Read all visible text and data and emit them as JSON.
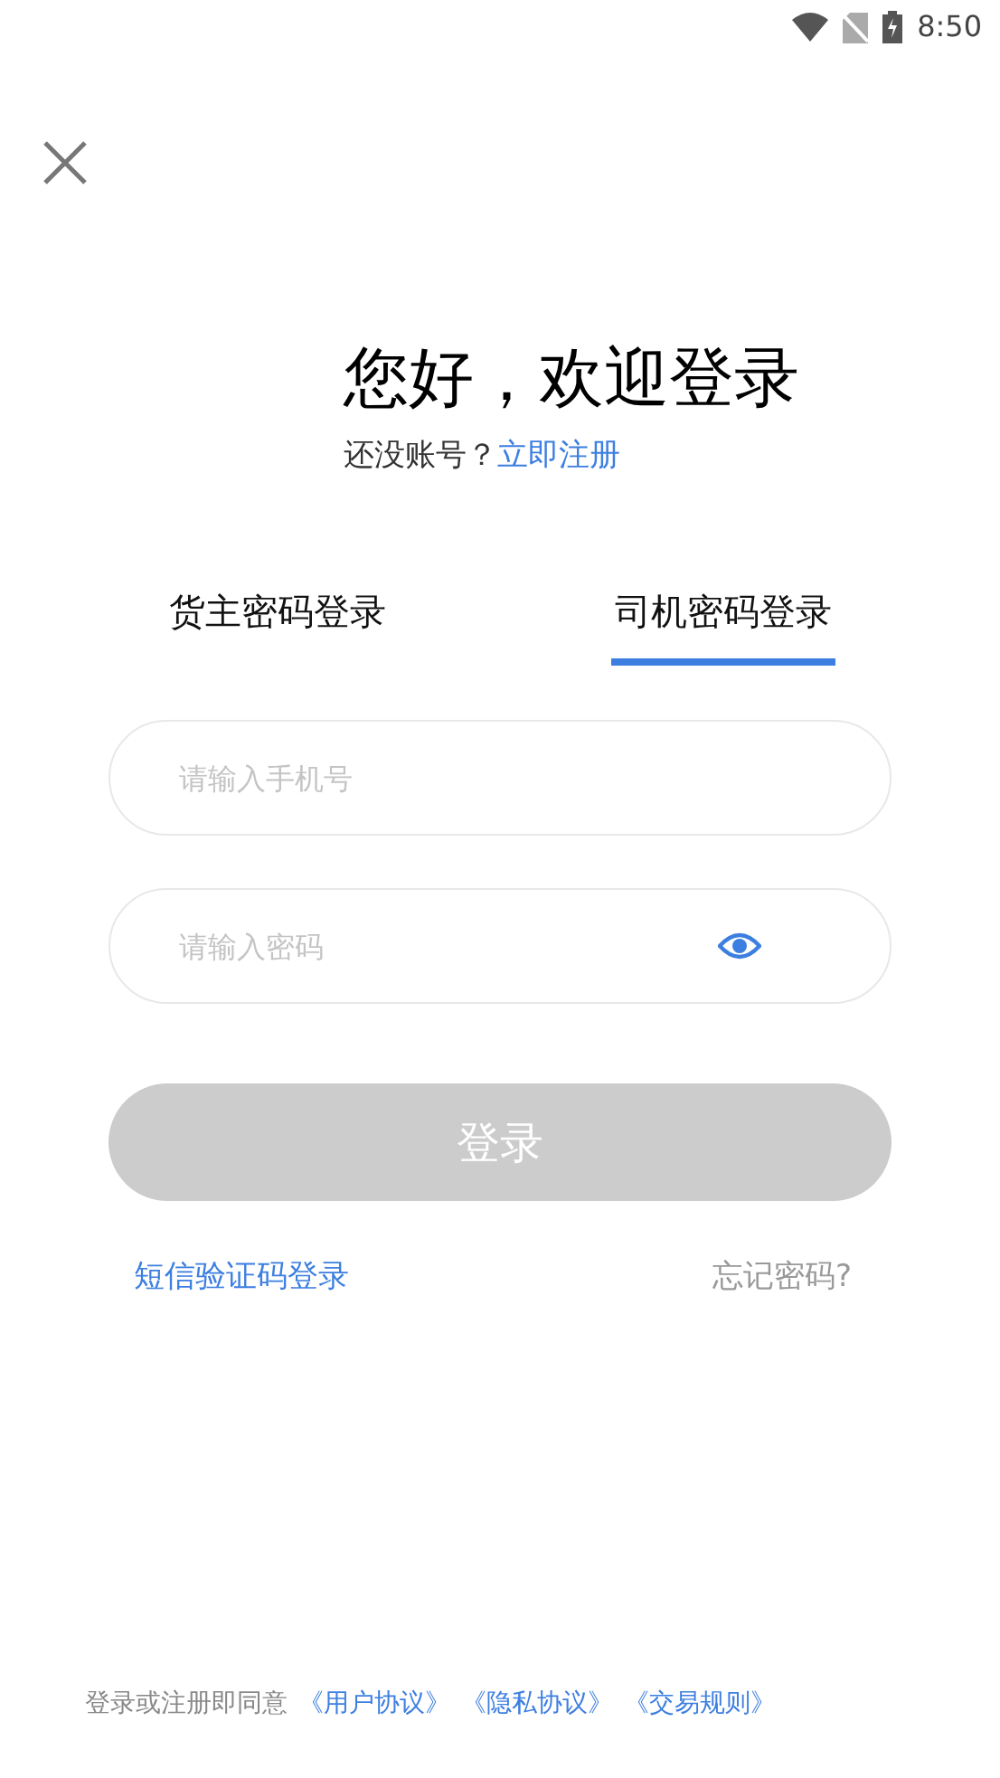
{
  "status_bar": {
    "time": "8:50"
  },
  "title": "您好，欢迎登录",
  "subtitle": {
    "text": "还没账号？",
    "link": "立即注册"
  },
  "tabs": [
    {
      "label": "货主密码登录",
      "selected": false
    },
    {
      "label": "司机密码登录",
      "selected": true
    }
  ],
  "phone_field": {
    "placeholder": "请输入手机号"
  },
  "password_field": {
    "placeholder": "请输入密码"
  },
  "login_button": {
    "label": "登录",
    "disabled": true
  },
  "sms_login_link": "短信验证码登录",
  "forgot_password_link": "忘记密码?",
  "agreement": {
    "text": "登录或注册即同意",
    "links": [
      "《用户协议》",
      "《隐私协议》",
      "《交易规则》"
    ]
  }
}
